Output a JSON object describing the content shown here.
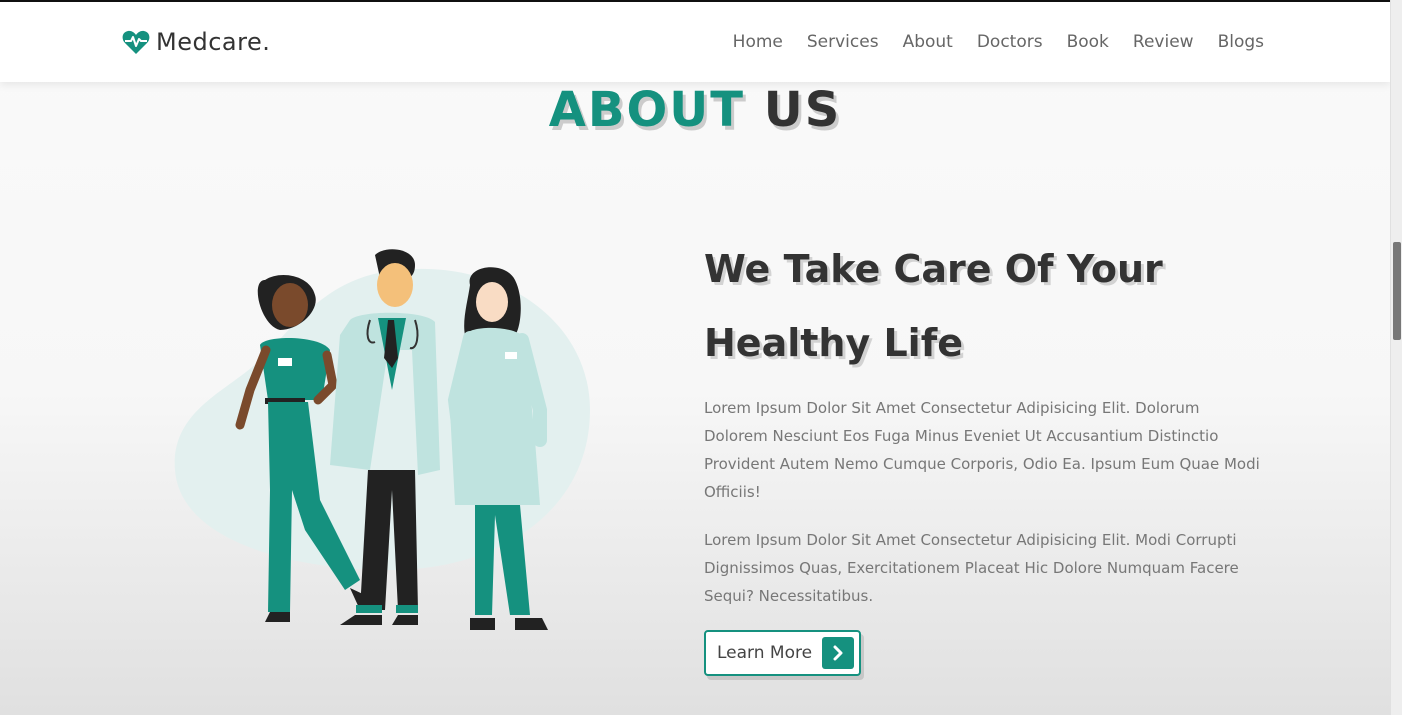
{
  "brand": {
    "name": "Medcare.",
    "icon": "heart-pulse-icon",
    "accent": "#15917f"
  },
  "nav": {
    "items": [
      {
        "label": "Home"
      },
      {
        "label": "Services"
      },
      {
        "label": "About"
      },
      {
        "label": "Doctors"
      },
      {
        "label": "Book"
      },
      {
        "label": "Review"
      },
      {
        "label": "Blogs"
      }
    ]
  },
  "section": {
    "heading_accent": "ABOUT",
    "heading_rest": "US"
  },
  "about": {
    "title_line1": "We Take Care Of Your",
    "title_line2": "Healthy Life",
    "paragraph1": "Lorem Ipsum Dolor Sit Amet Consectetur Adipisicing Elit. Dolorum Dolorem Nesciunt Eos Fuga Minus Eveniet Ut Accusantium Distinctio Provident Autem Nemo Cumque Corporis, Odio Ea. Ipsum Eum Quae Modi Officiis!",
    "paragraph2": "Lorem Ipsum Dolor Sit Amet Consectetur Adipisicing Elit. Modi Corrupti Dignissimos Quas, Exercitationem Placeat Hic Dolore Numquam Facere Sequi? Necessitatibus.",
    "button_label": "Learn More",
    "button_icon": "chevron-right-icon"
  }
}
